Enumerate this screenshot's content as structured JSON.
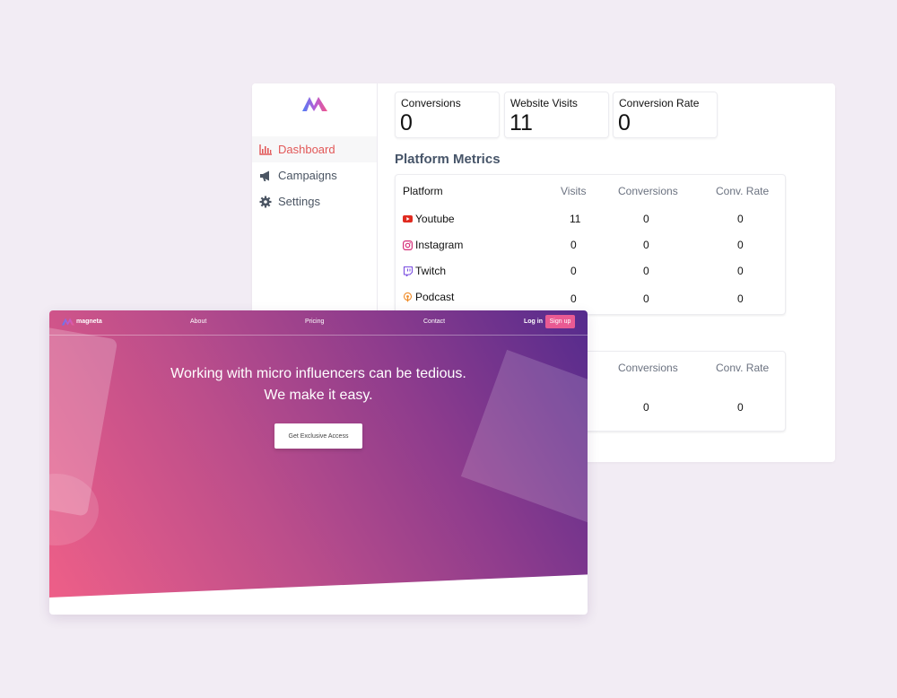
{
  "dashboard": {
    "nav": [
      {
        "label": "Dashboard",
        "icon": "bar-chart-icon",
        "active": true
      },
      {
        "label": "Campaigns",
        "icon": "megaphone-icon",
        "active": false
      },
      {
        "label": "Settings",
        "icon": "gear-icon",
        "active": false
      }
    ],
    "stats": [
      {
        "label": "Conversions",
        "value": "0"
      },
      {
        "label": "Website Visits",
        "value": "11"
      },
      {
        "label": "Conversion Rate",
        "value": "0"
      }
    ],
    "section_title": "Platform Metrics",
    "table": {
      "headers": [
        "Platform",
        "Visits",
        "Conversions",
        "Conv. Rate"
      ],
      "rows": [
        {
          "platform": "Youtube",
          "icon": "youtube-icon",
          "visits": "11",
          "conversions": "0",
          "rate": "0"
        },
        {
          "platform": "Instagram",
          "icon": "instagram-icon",
          "visits": "0",
          "conversions": "0",
          "rate": "0"
        },
        {
          "platform": "Twitch",
          "icon": "twitch-icon",
          "visits": "0",
          "conversions": "0",
          "rate": "0"
        },
        {
          "platform": "Podcast",
          "icon": "podcast-icon",
          "visits": "0",
          "conversions": "0",
          "rate": "0"
        }
      ]
    },
    "table2": {
      "headers": [
        "Conversions",
        "Conv. Rate"
      ],
      "row": {
        "conversions": "0",
        "rate": "0"
      }
    }
  },
  "landing": {
    "brand": "magneta",
    "nav": [
      "About",
      "Pricing",
      "Contact"
    ],
    "login": "Log in",
    "signup": "Sign up",
    "headline_1": "Working with micro influencers can be tedious.",
    "headline_2": "We make it easy.",
    "cta": "Get Exclusive Access"
  },
  "colors": {
    "accent": "#e25858",
    "background": "#f2ecf4",
    "hero_start": "#ee5f88",
    "hero_end": "#552b8d"
  }
}
